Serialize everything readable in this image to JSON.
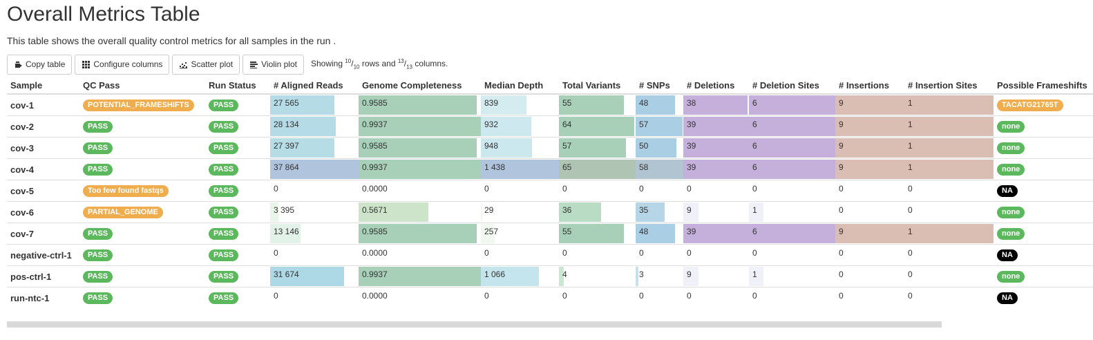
{
  "page": {
    "title": "Overall Metrics Table",
    "description": "This table shows the overall quality control metrics for all samples in the run ."
  },
  "toolbar": {
    "copy_label": "Copy table",
    "configure_label": "Configure columns",
    "scatter_label": "Scatter plot",
    "violin_label": "Violin plot",
    "showing_prefix": "Showing ",
    "rows_shown": "10",
    "rows_total": "10",
    "rows_word": " rows and ",
    "cols_shown": "13",
    "cols_total": "13",
    "cols_word": " columns."
  },
  "colors": {
    "pass": "#5cb85c",
    "warn": "#f0ad4e",
    "na": "#000000"
  },
  "table": {
    "headers": [
      "Sample",
      "QC Pass",
      "Run Status",
      "# Aligned Reads",
      "Genome Completeness",
      "Median Depth",
      "Total Variants",
      "# SNPs",
      "# Deletions",
      "# Deletion Sites",
      "# Insertions",
      "# Insertion Sites",
      "Possible Frameshifts"
    ],
    "rows": [
      {
        "sample": "cov-1",
        "qc": "POTENTIAL_FRAMESHIFTS",
        "qc_color": "warn",
        "run_status": "PASS",
        "aligned_reads": "27 565",
        "aligned_reads_frac": 0.728,
        "completeness": "0.9585",
        "completeness_frac": 0.965,
        "depth": "839",
        "depth_frac": 0.583,
        "total_variants": "55",
        "total_variants_frac": 0.846,
        "snps": "48",
        "snps_frac": 0.828,
        "deletions": "38",
        "deletions_frac": 0.974,
        "deletion_sites": "6",
        "deletion_sites_frac": 1.0,
        "insertions": "9",
        "insertions_frac": 1.0,
        "insertion_sites": "1",
        "insertion_sites_frac": 1.0,
        "frameshifts": "TACATG21765T",
        "frameshifts_color": "warn"
      },
      {
        "sample": "cov-2",
        "qc": "PASS",
        "qc_color": "pass",
        "run_status": "PASS",
        "aligned_reads": "28 134",
        "aligned_reads_frac": 0.743,
        "completeness": "0.9937",
        "completeness_frac": 1.0,
        "depth": "932",
        "depth_frac": 0.648,
        "total_variants": "64",
        "total_variants_frac": 0.985,
        "snps": "57",
        "snps_frac": 0.983,
        "deletions": "39",
        "deletions_frac": 1.0,
        "deletion_sites": "6",
        "deletion_sites_frac": 1.0,
        "insertions": "9",
        "insertions_frac": 1.0,
        "insertion_sites": "1",
        "insertion_sites_frac": 1.0,
        "frameshifts": "none",
        "frameshifts_color": "pass"
      },
      {
        "sample": "cov-3",
        "qc": "PASS",
        "qc_color": "pass",
        "run_status": "PASS",
        "aligned_reads": "27 397",
        "aligned_reads_frac": 0.724,
        "completeness": "0.9585",
        "completeness_frac": 0.965,
        "depth": "948",
        "depth_frac": 0.659,
        "total_variants": "57",
        "total_variants_frac": 0.877,
        "snps": "50",
        "snps_frac": 0.862,
        "deletions": "39",
        "deletions_frac": 1.0,
        "deletion_sites": "6",
        "deletion_sites_frac": 1.0,
        "insertions": "9",
        "insertions_frac": 1.0,
        "insertion_sites": "1",
        "insertion_sites_frac": 1.0,
        "frameshifts": "none",
        "frameshifts_color": "pass"
      },
      {
        "sample": "cov-4",
        "qc": "PASS",
        "qc_color": "pass",
        "run_status": "PASS",
        "aligned_reads": "37 864",
        "aligned_reads_frac": 1.0,
        "completeness": "0.9937",
        "completeness_frac": 1.0,
        "depth": "1 438",
        "depth_frac": 1.0,
        "total_variants": "65",
        "total_variants_frac": 1.0,
        "snps": "58",
        "snps_frac": 1.0,
        "deletions": "39",
        "deletions_frac": 1.0,
        "deletion_sites": "6",
        "deletion_sites_frac": 1.0,
        "insertions": "9",
        "insertions_frac": 1.0,
        "insertion_sites": "1",
        "insertion_sites_frac": 1.0,
        "frameshifts": "none",
        "frameshifts_color": "pass"
      },
      {
        "sample": "cov-5",
        "qc": "Too few found fastqs",
        "qc_color": "warn",
        "run_status": "PASS",
        "aligned_reads": "0",
        "aligned_reads_frac": 0,
        "completeness": "0.0000",
        "completeness_frac": 0,
        "depth": "0",
        "depth_frac": 0,
        "total_variants": "0",
        "total_variants_frac": 0,
        "snps": "0",
        "snps_frac": 0,
        "deletions": "0",
        "deletions_frac": 0,
        "deletion_sites": "0",
        "deletion_sites_frac": 0,
        "insertions": "0",
        "insertions_frac": 0,
        "insertion_sites": "0",
        "insertion_sites_frac": 0,
        "frameshifts": "NA",
        "frameshifts_color": "na"
      },
      {
        "sample": "cov-6",
        "qc": "PARTIAL_GENOME",
        "qc_color": "warn",
        "run_status": "PASS",
        "aligned_reads": "3 395",
        "aligned_reads_frac": 0.09,
        "completeness": "0.5671",
        "completeness_frac": 0.571,
        "depth": "29",
        "depth_frac": 0.02,
        "total_variants": "36",
        "total_variants_frac": 0.554,
        "snps": "35",
        "snps_frac": 0.603,
        "deletions": "9",
        "deletions_frac": 0.231,
        "deletion_sites": "1",
        "deletion_sites_frac": 0.167,
        "insertions": "0",
        "insertions_frac": 0,
        "insertion_sites": "0",
        "insertion_sites_frac": 0,
        "frameshifts": "none",
        "frameshifts_color": "pass"
      },
      {
        "sample": "cov-7",
        "qc": "PASS",
        "qc_color": "pass",
        "run_status": "PASS",
        "aligned_reads": "13 146",
        "aligned_reads_frac": 0.347,
        "completeness": "0.9585",
        "completeness_frac": 0.965,
        "depth": "257",
        "depth_frac": 0.179,
        "total_variants": "55",
        "total_variants_frac": 0.846,
        "snps": "48",
        "snps_frac": 0.828,
        "deletions": "39",
        "deletions_frac": 1.0,
        "deletion_sites": "6",
        "deletion_sites_frac": 1.0,
        "insertions": "9",
        "insertions_frac": 1.0,
        "insertion_sites": "1",
        "insertion_sites_frac": 1.0,
        "frameshifts": "none",
        "frameshifts_color": "pass"
      },
      {
        "sample": "negative-ctrl-1",
        "qc": "PASS",
        "qc_color": "pass",
        "run_status": "PASS",
        "aligned_reads": "0",
        "aligned_reads_frac": 0,
        "completeness": "0.0000",
        "completeness_frac": 0,
        "depth": "0",
        "depth_frac": 0,
        "total_variants": "0",
        "total_variants_frac": 0,
        "snps": "0",
        "snps_frac": 0,
        "deletions": "0",
        "deletions_frac": 0,
        "deletion_sites": "0",
        "deletion_sites_frac": 0,
        "insertions": "0",
        "insertions_frac": 0,
        "insertion_sites": "0",
        "insertion_sites_frac": 0,
        "frameshifts": "NA",
        "frameshifts_color": "na"
      },
      {
        "sample": "pos-ctrl-1",
        "qc": "PASS",
        "qc_color": "pass",
        "run_status": "PASS",
        "aligned_reads": "31 674",
        "aligned_reads_frac": 0.836,
        "completeness": "0.9937",
        "completeness_frac": 1.0,
        "depth": "1 066",
        "depth_frac": 0.741,
        "total_variants": "4",
        "total_variants_frac": 0.062,
        "snps": "3",
        "snps_frac": 0.052,
        "deletions": "9",
        "deletions_frac": 0.231,
        "deletion_sites": "1",
        "deletion_sites_frac": 0.167,
        "insertions": "0",
        "insertions_frac": 0,
        "insertion_sites": "0",
        "insertion_sites_frac": 0,
        "frameshifts": "none",
        "frameshifts_color": "pass"
      },
      {
        "sample": "run-ntc-1",
        "qc": "PASS",
        "qc_color": "pass",
        "run_status": "PASS",
        "aligned_reads": "0",
        "aligned_reads_frac": 0,
        "completeness": "0.0000",
        "completeness_frac": 0,
        "depth": "0",
        "depth_frac": 0,
        "total_variants": "0",
        "total_variants_frac": 0,
        "snps": "0",
        "snps_frac": 0,
        "deletions": "0",
        "deletions_frac": 0,
        "deletion_sites": "0",
        "deletion_sites_frac": 0,
        "insertions": "0",
        "insertions_frac": 0,
        "insertion_sites": "0",
        "insertion_sites_frac": 0,
        "frameshifts": "NA",
        "frameshifts_color": "na"
      }
    ]
  }
}
